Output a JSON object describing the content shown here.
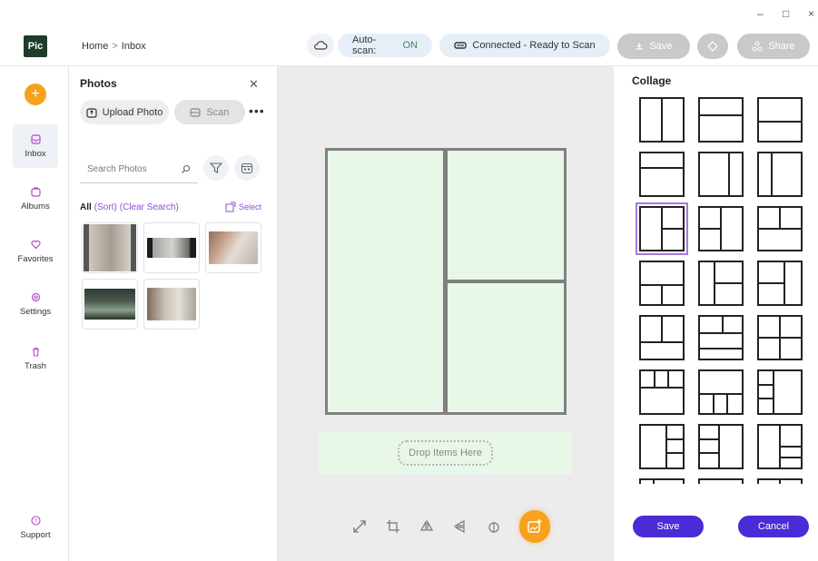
{
  "window": {
    "min": "–",
    "max": "□",
    "close": "×"
  },
  "app": {
    "logo_text": "Pic"
  },
  "breadcrumb": {
    "home": "Home",
    "separator": ">",
    "current": "Inbox"
  },
  "header": {
    "autoscan_label": "Auto-scan:",
    "autoscan_value": "ON",
    "connection_status": "Connected - Ready to Scan",
    "save_label": "Save",
    "share_label": "Share"
  },
  "nav": {
    "items": [
      {
        "label": "Inbox",
        "icon": "inbox-icon",
        "active": true
      },
      {
        "label": "Albums",
        "icon": "albums-icon",
        "active": false
      },
      {
        "label": "Favorites",
        "icon": "heart-icon",
        "active": false
      },
      {
        "label": "Settings",
        "icon": "gear-icon",
        "active": false
      },
      {
        "label": "Trash",
        "icon": "trash-icon",
        "active": false
      }
    ],
    "support_label": "Support"
  },
  "photos": {
    "title": "Photos",
    "upload_label": "Upload Photo",
    "scan_label": "Scan",
    "search_placeholder": "Search Photos",
    "all_label": "All",
    "sort_label": "(Sort)",
    "clear_label": "(Clear Search)",
    "select_label": "Select",
    "thumbnails": 5
  },
  "canvas": {
    "drop_label": "Drop Items Here"
  },
  "collage": {
    "title": "Collage",
    "save_label": "Save",
    "cancel_label": "Cancel",
    "selected_layout_index": 6
  },
  "colors": {
    "accent_orange": "#f6a21e",
    "accent_purple": "#4a2bd6",
    "link_purple": "#8a4fd6",
    "cell_green": "#e8f7e8",
    "nav_icon": "#b04bc9"
  }
}
